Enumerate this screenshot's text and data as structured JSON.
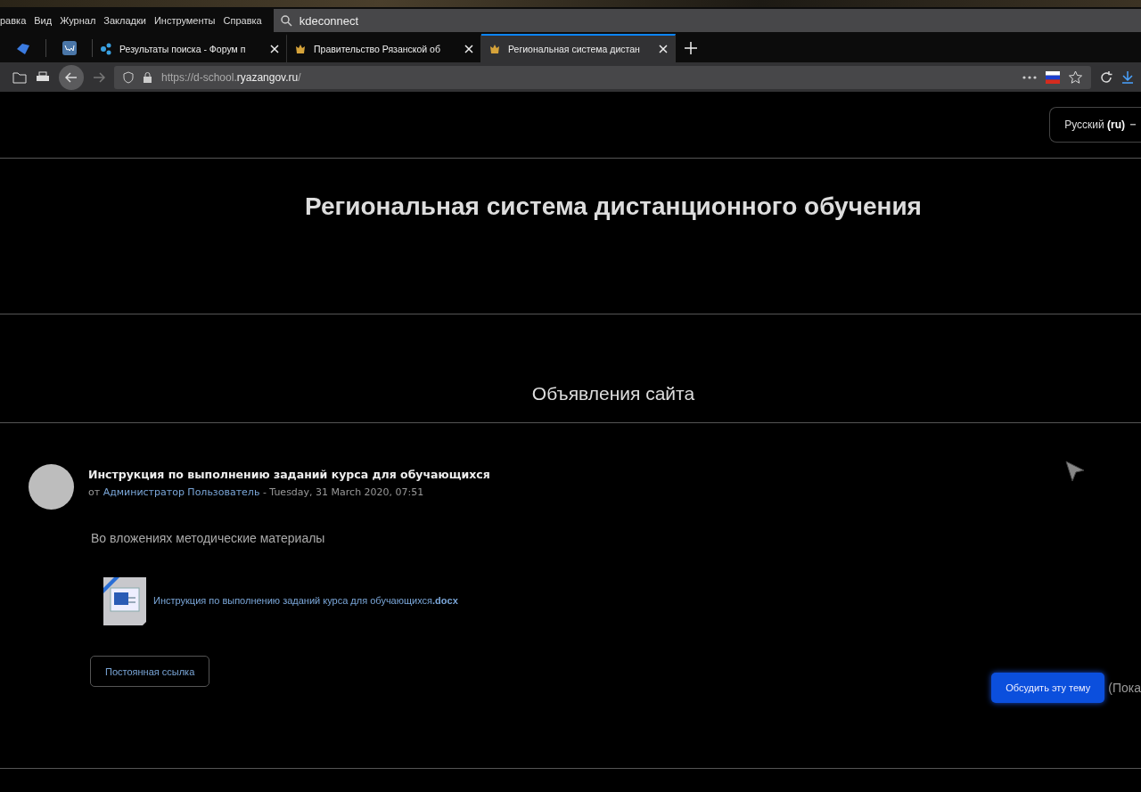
{
  "menu": [
    "равка",
    "Вид",
    "Журнал",
    "Закладки",
    "Инструменты",
    "Справка"
  ],
  "search": {
    "value": "kdeconnect"
  },
  "pinned_tabs": [
    {
      "kind": "bird"
    },
    {
      "kind": "vk"
    }
  ],
  "tabs": [
    {
      "label": "Результаты поиска - Форум п",
      "kind": "network",
      "selected": false
    },
    {
      "label": "Правительство Рязанской об",
      "kind": "crest",
      "selected": false
    },
    {
      "label": "Региональная система дистан",
      "kind": "crest",
      "selected": true
    }
  ],
  "address": {
    "prefix": "https://d-school.",
    "domain": "ryazangov.ru",
    "suffix": "/"
  },
  "language": "Русский **(ru)**",
  "site_title": "Региональная система дистанционного обучения",
  "section_title": "Объявления сайта",
  "post": {
    "title": "Инструкция по выполнению заданий курса для обучающихся",
    "by": "от",
    "author": "Администратор Пользователь",
    "date": "- Tuesday, 31 March 2020, 07:51",
    "body": "Во вложениях методические материалы",
    "attachment": "Инструкция по выполнению заданий курса для обучающихся**.docx**",
    "permalink": "Постоянная ссылка"
  },
  "discuss_button": "Обсудить эту тему",
  "replies_note": "(Пока"
}
